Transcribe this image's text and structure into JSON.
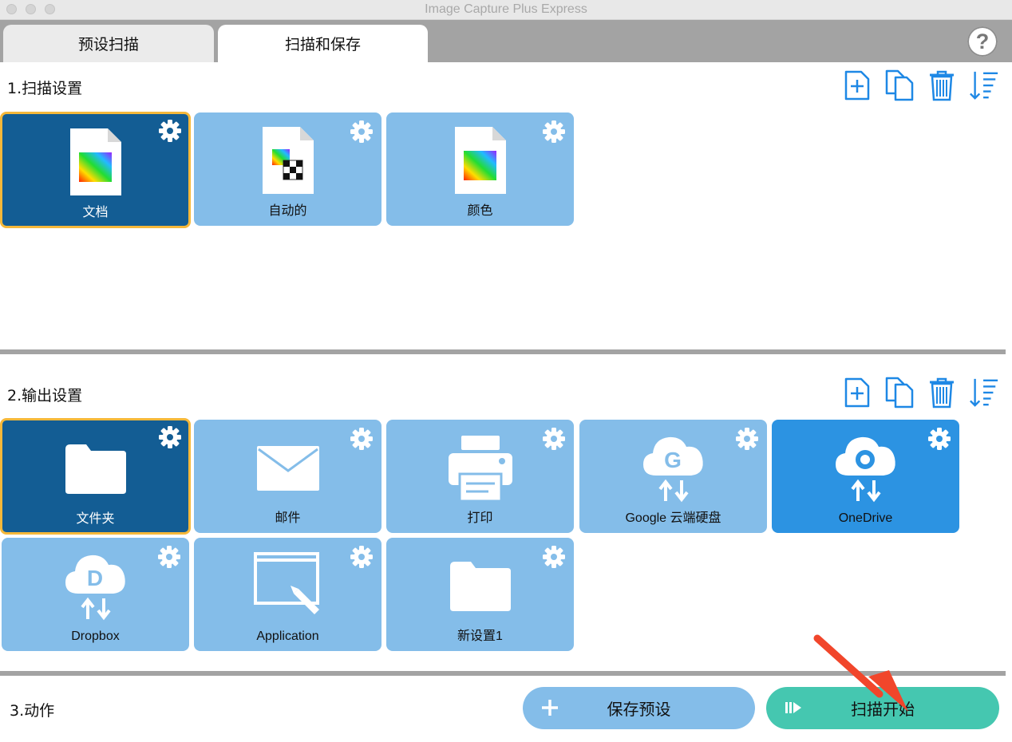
{
  "window": {
    "title": "Image Capture Plus Express"
  },
  "tabs": [
    {
      "label": "预设扫描"
    },
    {
      "label": "扫描和保存"
    }
  ],
  "help": {
    "label": "?"
  },
  "scan_settings": {
    "heading": "1.扫描设置",
    "tiles": [
      {
        "label": "文档",
        "icon": "color-document-icon",
        "selected": true
      },
      {
        "label": "自动的",
        "icon": "auto-document-icon",
        "selected": false
      },
      {
        "label": "颜色",
        "icon": "color-document-icon",
        "selected": false
      }
    ]
  },
  "output_settings": {
    "heading": "2.输出设置",
    "tiles": [
      {
        "label": "文件夹",
        "icon": "folder-icon",
        "selected": true
      },
      {
        "label": "邮件",
        "icon": "mail-icon",
        "selected": false
      },
      {
        "label": "打印",
        "icon": "printer-icon",
        "selected": false
      },
      {
        "label": "Google 云端硬盘",
        "icon": "google-drive-cloud-icon",
        "selected": false
      },
      {
        "label": "OneDrive",
        "icon": "onedrive-cloud-icon",
        "selected": false
      },
      {
        "label": "Dropbox",
        "icon": "dropbox-cloud-icon",
        "selected": false
      },
      {
        "label": "Application",
        "icon": "application-icon",
        "selected": false
      },
      {
        "label": "新设置1",
        "icon": "folder-icon",
        "selected": false
      }
    ]
  },
  "actions": {
    "heading": "3.动作",
    "save_preset_label": "保存预设",
    "start_scan_label": "扫描开始"
  },
  "colors": {
    "tile_normal": "#84bde9",
    "tile_selected": "#135d94",
    "tile_selected_border": "#f5b83a",
    "tile_onedrive": "#2c93e2",
    "toolbar_icon": "#1e88e5",
    "start_button": "#45c7b0",
    "annotation_arrow": "#f1462b"
  }
}
